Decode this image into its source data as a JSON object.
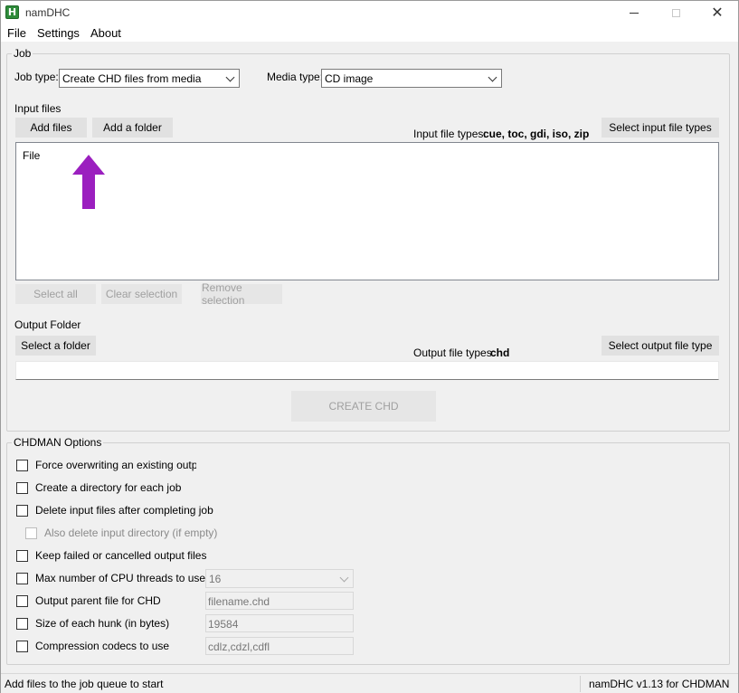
{
  "window": {
    "title": "namDHC",
    "app_icon_letter": "H"
  },
  "menu": [
    "File",
    "Settings",
    "About"
  ],
  "job": {
    "group_title": "Job",
    "job_type_label": "Job type:",
    "job_type_value": "Create CHD files from media",
    "media_type_label": "Media type:",
    "media_type_value": "CD image",
    "input_files_label": "Input files",
    "add_files": "Add files",
    "add_folder": "Add a folder",
    "input_types_label": "Input file types:",
    "input_types_value": "cue, toc, gdi, iso, zip",
    "select_input_types": "Select input file types",
    "list_header": "File",
    "select_all": "Select all",
    "clear_selection": "Clear selection",
    "remove_selection": "Remove selection",
    "output_folder_label": "Output Folder",
    "select_folder": "Select a folder",
    "output_types_label": "Output file types:",
    "output_types_value": "chd",
    "select_output_type": "Select output file type",
    "create_chd": "CREATE CHD"
  },
  "options": {
    "group_title": "CHDMAN Options",
    "force_overwrite": "Force overwriting an existing output file",
    "create_directory": "Create a directory for each job",
    "delete_input": "Delete input files after completing job",
    "also_delete_dir": "Also delete input directory (if empty)",
    "keep_failed": "Keep failed or cancelled output files",
    "max_threads": "Max number of CPU threads to use",
    "max_threads_value": "16",
    "parent_file": "Output parent file for CHD",
    "parent_file_value": "filename.chd",
    "hunk_size": "Size of each hunk (in bytes)",
    "hunk_size_value": "19584",
    "codecs": "Compression codecs to use",
    "codecs_value": "cdlz,cdzl,cdfl"
  },
  "status": {
    "left": "Add files to the job queue to start",
    "right": "namDHC v1.13 for CHDMAN"
  },
  "colors": {
    "arrow": "#9b1fbf"
  },
  "annotation_icon": "arrow-up-icon"
}
